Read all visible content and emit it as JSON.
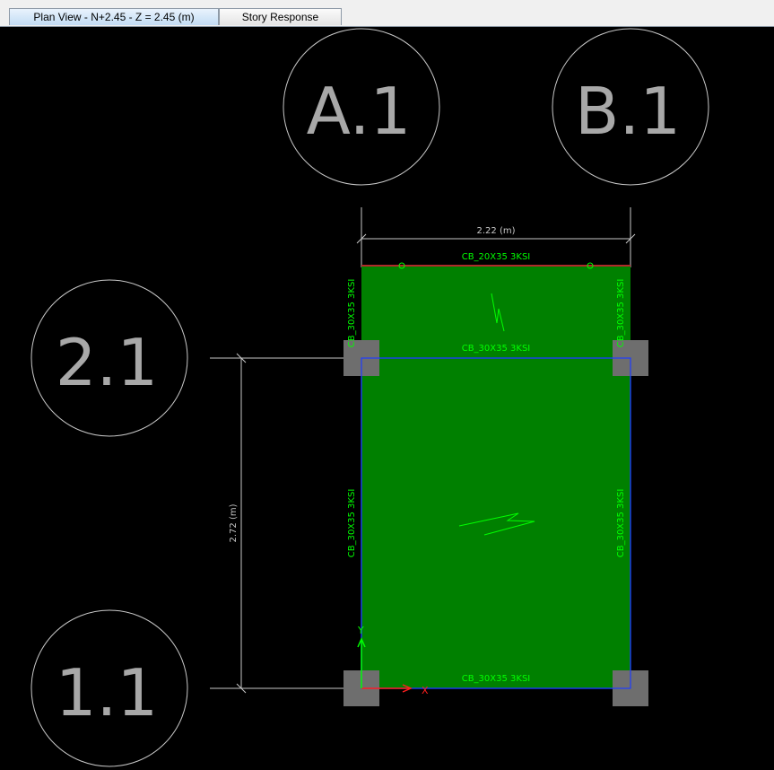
{
  "tabs": [
    {
      "label": "Plan View - N+2.45 - Z = 2.45 (m)",
      "active": true
    },
    {
      "label": "Story Response",
      "active": false
    }
  ],
  "grid_bubbles": {
    "col_a": "A.1",
    "col_b": "B.1",
    "row_2": "2.1",
    "row_1": "1.1"
  },
  "dimensions": {
    "horizontal": "2.22 (m)",
    "vertical": "2.72 (m)"
  },
  "beams": {
    "top_edge": "CB_20X35 3KSI",
    "middle": "CB_30X35 3KSI",
    "bottom": "CB_30X35 3KSI",
    "left_upper": "CB_30X35 3KSI",
    "right_upper": "CB_30X35 3KSI",
    "left_lower": "CB_30X35 3KSI",
    "right_lower": "CB_30X35 3KSI"
  },
  "axes": {
    "x": "X",
    "y": "Y"
  },
  "colors": {
    "background": "#000000",
    "slab": "#008000",
    "label_green": "#00ff00",
    "grid_line": "#c8c8c8",
    "column": "#6e6e6e",
    "edge_blue": "#1e3cff",
    "axis_red": "#ff1e1e"
  }
}
